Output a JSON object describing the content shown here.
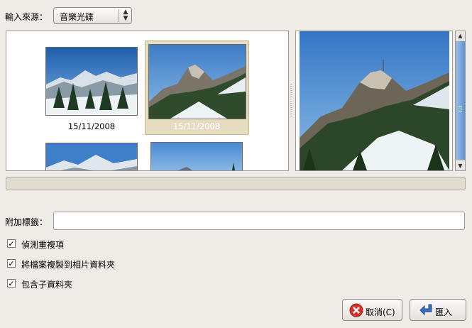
{
  "source": {
    "label": "輸入來源：",
    "selected": "音樂光碟"
  },
  "thumbnails": [
    {
      "date": "15/11/2008",
      "selected": false
    },
    {
      "date": "15/11/2008",
      "selected": true
    },
    {
      "date": "",
      "selected": false
    },
    {
      "date": "",
      "selected": false
    }
  ],
  "tags": {
    "label": "附加標籤：",
    "value": ""
  },
  "options": [
    {
      "label": "偵測重複項",
      "checked": true
    },
    {
      "label": "將檔案複製到相片資料夾",
      "checked": true
    },
    {
      "label": "包含子資料夾",
      "checked": true
    }
  ],
  "buttons": {
    "cancel": "取消(C)",
    "import": "匯入"
  },
  "colors": {
    "selection": "#e6ddc0",
    "window": "#efebe7",
    "scrollbar": "#5f93d4"
  }
}
